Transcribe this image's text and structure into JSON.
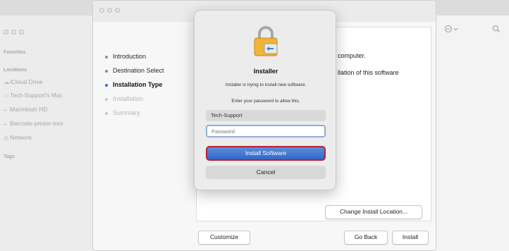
{
  "finder": {
    "sidebar_sections": {
      "favorites": "Favorites",
      "locations": "Locations",
      "tags": "Tags"
    },
    "locations": [
      {
        "label": "iCloud Drive",
        "icon": "cloud-icon"
      },
      {
        "label": "Tech-Support's Mac",
        "icon": "laptop-icon"
      },
      {
        "label": "Macintosh HD",
        "icon": "disk-icon"
      },
      {
        "label": "Barcode-printer-tool",
        "icon": "disk-icon"
      },
      {
        "label": "Network",
        "icon": "globe-icon"
      }
    ],
    "toolbar_icons": [
      "more-options-icon",
      "search-icon"
    ]
  },
  "installer": {
    "steps": [
      {
        "label": "Introduction",
        "state": "done"
      },
      {
        "label": "Destination Select",
        "state": "done"
      },
      {
        "label": "Installation Type",
        "state": "current"
      },
      {
        "label": "Installation",
        "state": "pending"
      },
      {
        "label": "Summary",
        "state": "pending"
      }
    ],
    "pane_text_1": "computer.",
    "pane_text_2": "llation of this software",
    "change_location_label": "Change Install Location...",
    "customize_label": "Customize",
    "go_back_label": "Go Back",
    "install_label": "Install"
  },
  "dialog": {
    "icon": "lock-icon",
    "title": "Installer",
    "message": "Installer is trying to install new software.",
    "prompt": "Enter your password to allow this.",
    "username": "Tech-Support",
    "password_placeholder": "Password",
    "install_software_label": "Install Software",
    "cancel_label": "Cancel"
  },
  "colors": {
    "accent_blue": "#3467c4",
    "focus_outline": "#b2243a",
    "current_step": "#2f6fd8"
  }
}
